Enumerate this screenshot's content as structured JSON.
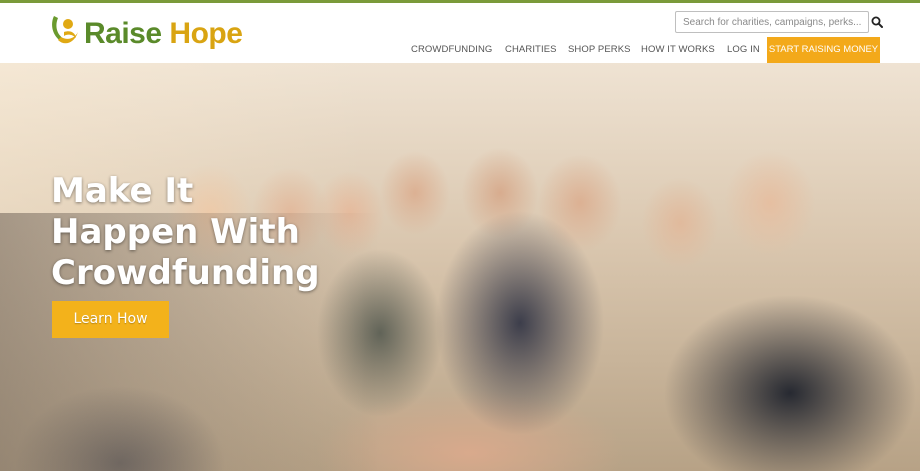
{
  "brand": {
    "name_part1": "Raise",
    "name_part2": "Hope",
    "color_green": "#5a8a2a",
    "color_gold": "#d9a412"
  },
  "search": {
    "placeholder": "Search for charities, campaigns, perks...",
    "icon": "search-icon"
  },
  "nav": {
    "items": [
      {
        "label": "CROWDFUNDING"
      },
      {
        "label": "CHARITIES"
      },
      {
        "label": "SHOP PERKS"
      },
      {
        "label": "HOW IT WORKS"
      },
      {
        "label": "LOG IN"
      }
    ],
    "cta_label": "START RAISING MONEY",
    "cta_color": "#f3a91a"
  },
  "hero": {
    "headline_line1": "Make It",
    "headline_line2": "Happen With",
    "headline_line3": "Crowdfunding",
    "button_label": "Learn How",
    "button_color": "#f3b21b"
  }
}
